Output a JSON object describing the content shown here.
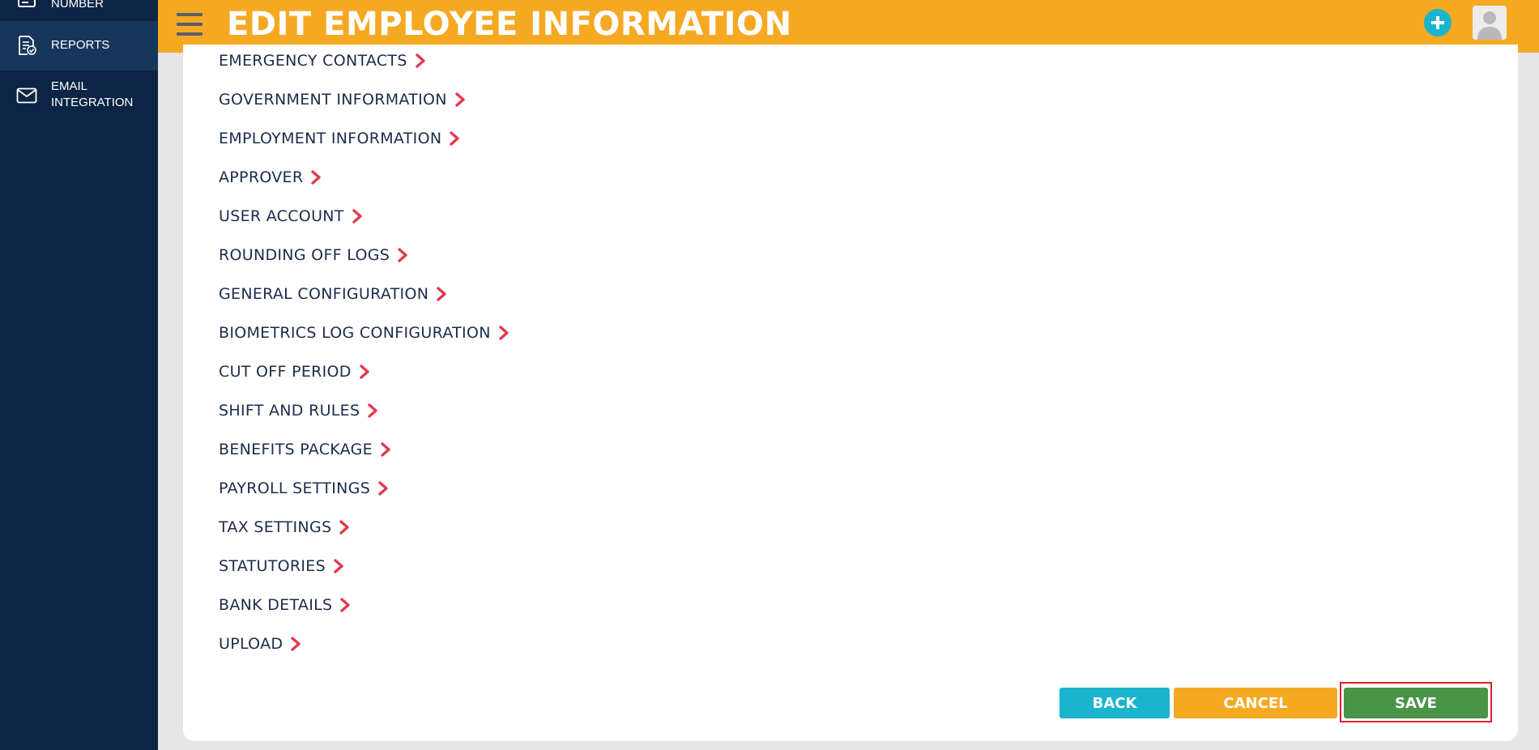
{
  "sidebar": {
    "items": [
      {
        "label": "NUMBER",
        "icon": "list-icon"
      },
      {
        "label": "REPORTS",
        "icon": "report-icon"
      },
      {
        "label_line1": "EMAIL",
        "label_line2": "INTEGRATION",
        "icon": "mail-icon"
      }
    ]
  },
  "header": {
    "title": "EDIT EMPLOYEE INFORMATION",
    "add_icon": "plus-icon",
    "avatar_icon": "user-avatar-icon"
  },
  "sections": [
    "EMERGENCY CONTACTS",
    "GOVERNMENT INFORMATION",
    "EMPLOYMENT INFORMATION",
    "APPROVER",
    "USER ACCOUNT",
    "ROUNDING OFF LOGS",
    "GENERAL CONFIGURATION",
    "BIOMETRICS LOG CONFIGURATION",
    "CUT OFF PERIOD",
    "SHIFT AND RULES",
    "BENEFITS PACKAGE",
    "PAYROLL SETTINGS",
    "TAX SETTINGS",
    "STATUTORIES",
    "BANK DETAILS",
    "UPLOAD"
  ],
  "actions": {
    "back": "BACK",
    "cancel": "CANCEL",
    "save": "SAVE"
  },
  "colors": {
    "header": "#f5a922",
    "sidebar": "#0c2545",
    "chevron": "#e03a4e",
    "back": "#1ab4cf",
    "cancel": "#f5a922",
    "save": "#4a9447",
    "highlight": "#e01f26"
  }
}
